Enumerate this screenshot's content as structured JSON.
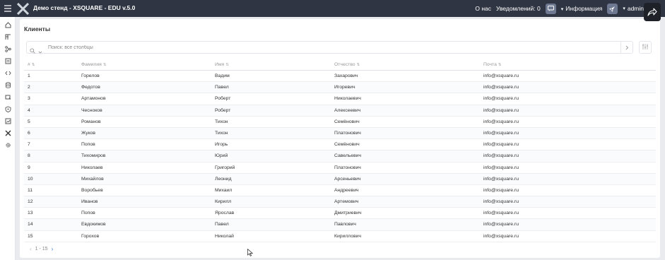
{
  "header": {
    "app_title": "Демо стенд - XSQUARE - EDU v.5.0",
    "about": "О нас",
    "notifications": "Уведомлений: 0",
    "info": "Информация",
    "user": "admin"
  },
  "page": {
    "title": "Клиенты",
    "search_placeholder": "Поиск: все столбцы"
  },
  "table": {
    "headers": {
      "num": "#",
      "last_name": "Фамилия",
      "first_name": "Имя",
      "patronymic": "Отчество",
      "email": "Почта"
    },
    "rows": [
      {
        "num": "1",
        "last_name": "Горелов",
        "first_name": "Вадим",
        "patronymic": "Захарович",
        "email": "info@xsquare.ru"
      },
      {
        "num": "2",
        "last_name": "Федотов",
        "first_name": "Павел",
        "patronymic": "Игоревич",
        "email": "info@xsquare.ru"
      },
      {
        "num": "3",
        "last_name": "Артамонов",
        "first_name": "Роберт",
        "patronymic": "Николаевич",
        "email": "info@xsquare.ru"
      },
      {
        "num": "4",
        "last_name": "Чесноков",
        "first_name": "Роберт",
        "patronymic": "Алексеевич",
        "email": "info@xsquare.ru"
      },
      {
        "num": "5",
        "last_name": "Романов",
        "first_name": "Тихон",
        "patronymic": "Семёнович",
        "email": "info@xsquare.ru"
      },
      {
        "num": "6",
        "last_name": "Жуков",
        "first_name": "Тихон",
        "patronymic": "Платонович",
        "email": "info@xsquare.ru"
      },
      {
        "num": "7",
        "last_name": "Попов",
        "first_name": "Игорь",
        "patronymic": "Семёнович",
        "email": "info@xsquare.ru"
      },
      {
        "num": "8",
        "last_name": "Тихомиров",
        "first_name": "Юрий",
        "patronymic": "Савельевич",
        "email": "info@xsquare.ru"
      },
      {
        "num": "9",
        "last_name": "Николаев",
        "first_name": "Григорий",
        "patronymic": "Платонович",
        "email": "info@xsquare.ru"
      },
      {
        "num": "10",
        "last_name": "Михайлов",
        "first_name": "Леонид",
        "patronymic": "Арсеньевич",
        "email": "info@xsquare.ru"
      },
      {
        "num": "11",
        "last_name": "Воробьев",
        "first_name": "Михаил",
        "patronymic": "Андреевич",
        "email": "info@xsquare.ru"
      },
      {
        "num": "12",
        "last_name": "Иванов",
        "first_name": "Кирилл",
        "patronymic": "Артемович",
        "email": "info@xsquare.ru"
      },
      {
        "num": "13",
        "last_name": "Попов",
        "first_name": "Ярослав",
        "patronymic": "Дмитриевич",
        "email": "info@xsquare.ru"
      },
      {
        "num": "14",
        "last_name": "Евдокимов",
        "first_name": "Павел",
        "patronymic": "Павлович",
        "email": "info@xsquare.ru"
      },
      {
        "num": "15",
        "last_name": "Горохов",
        "first_name": "Николай",
        "patronymic": "Кириллович",
        "email": "info@xsquare.ru"
      }
    ]
  },
  "pagination": {
    "range": "1 - 15"
  },
  "icons": {
    "sidebar": [
      "home-icon",
      "dashboard-icon",
      "flow-icon",
      "forms-icon",
      "code-icon",
      "database-icon",
      "integration-icon",
      "security-icon",
      "reports-icon",
      "tools-icon",
      "settings-icon"
    ],
    "header": [
      "menu-icon",
      "logo-icon",
      "chat-icon",
      "rocket-icon",
      "exit-icon"
    ]
  },
  "colors": {
    "topbar": "#2f3542",
    "accent": "#3b6fd6"
  }
}
